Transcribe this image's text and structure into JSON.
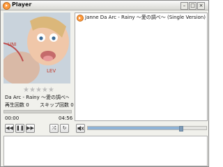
{
  "window": {
    "title": "Player"
  },
  "now_playing": {
    "track": "Da Arc - Rainy ～愛の調べ～ (Sin",
    "rating_stars": 0,
    "play_count_label": "再生回数",
    "play_count": "0",
    "skip_count_label": "スキップ回数",
    "skip_count": "0",
    "progress": 0,
    "time_elapsed": "00:00",
    "time_total": "04:56",
    "volume": 0.78
  },
  "playlist": {
    "items": [
      {
        "title": "Janne Da Arc - Rainy ～愛の調べ～ (Single Version)"
      }
    ]
  },
  "icons": {
    "app": "play-circle-icon",
    "controls": [
      "previous-icon",
      "pause-icon",
      "next-icon",
      "shuffle-icon",
      "repeat-icon"
    ],
    "volume": "speaker-muted-icon"
  }
}
